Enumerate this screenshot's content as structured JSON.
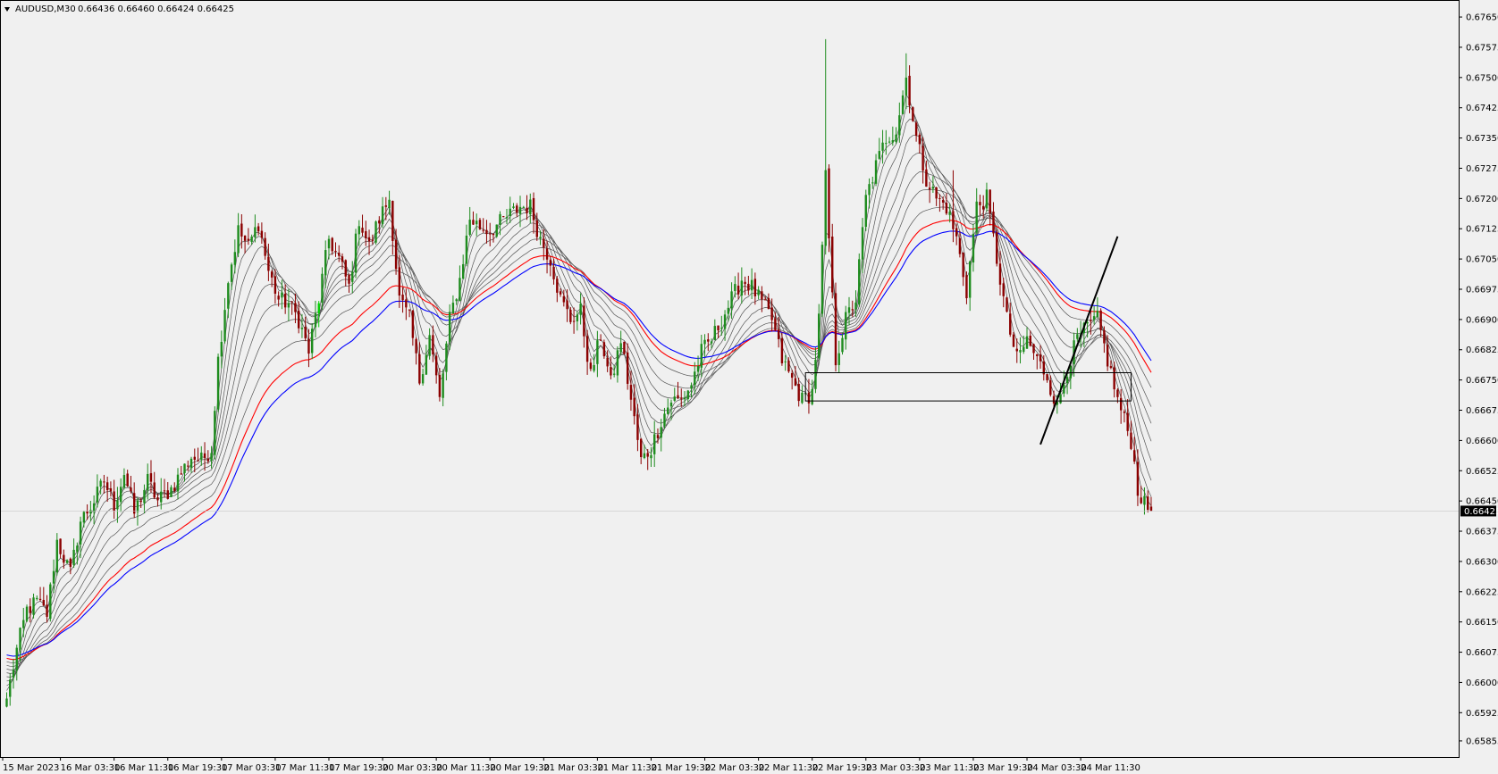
{
  "header": {
    "symbol": "AUDUSD,M30",
    "ohlc": "0.66436 0.66460 0.66424 0.66425"
  },
  "colors": {
    "background": "#f0f0f0",
    "bull_candle": "#1e8c1e",
    "bear_candle": "#8b0000",
    "ema_red": "#ff0000",
    "ema_blue": "#0000ff",
    "ema_gray": "#555555",
    "current_price_box": "#000000",
    "trendline": "#000000",
    "highlight_candle": "#00d000"
  },
  "chart_data": {
    "type": "candlestick",
    "title": "AUDUSD,M30",
    "ylim": [
      0.65815,
      0.6769
    ],
    "y_ticks": [
      0.6765,
      0.67575,
      0.675,
      0.67425,
      0.6735,
      0.67275,
      0.672,
      0.67125,
      0.6705,
      0.66975,
      0.669,
      0.66825,
      0.6675,
      0.66675,
      0.666,
      0.66525,
      0.6645,
      0.66375,
      0.663,
      0.66225,
      0.6615,
      0.66075,
      0.66,
      0.65925,
      0.65855
    ],
    "y_tick_labels": [
      "0.67650",
      "0.67575",
      "0.67500",
      "0.67425",
      "0.67350",
      "0.67275",
      "0.67200",
      "0.67125",
      "0.67050",
      "0.66975",
      "0.66900",
      "0.66825",
      "0.66750",
      "0.66675",
      "0.66600",
      "0.66525",
      "0.66450",
      "0.66375",
      "0.66300",
      "0.66225",
      "0.66150",
      "0.66075",
      "0.66000",
      "0.65925",
      "0.65855"
    ],
    "x_tick_labels": [
      "15 Mar 2023",
      "16 Mar 03:30",
      "16 Mar 11:30",
      "16 Mar 19:30",
      "17 Mar 03:30",
      "17 Mar 11:30",
      "17 Mar 19:30",
      "20 Mar 03:30",
      "20 Mar 11:30",
      "20 Mar 19:30",
      "21 Mar 03:30",
      "21 Mar 11:30",
      "21 Mar 19:30",
      "22 Mar 03:30",
      "22 Mar 11:30",
      "22 Mar 19:30",
      "23 Mar 03:30",
      "23 Mar 11:30",
      "23 Mar 19:30",
      "24 Mar 03:30",
      "24 Mar 11:30"
    ],
    "x_tick_index": [
      0,
      16,
      32,
      48,
      64,
      80,
      96,
      112,
      128,
      144,
      160,
      176,
      192,
      208,
      224,
      240,
      256,
      272,
      288,
      304,
      320
    ],
    "current_price": 0.66425,
    "current_price_label": "0.66425",
    "path_anchors": [
      [
        0,
        0.6596
      ],
      [
        3,
        0.6608
      ],
      [
        6,
        0.6618
      ],
      [
        9,
        0.662
      ],
      [
        12,
        0.6617
      ],
      [
        15,
        0.6635
      ],
      [
        19,
        0.6627
      ],
      [
        22,
        0.664
      ],
      [
        26,
        0.6645
      ],
      [
        29,
        0.665
      ],
      [
        32,
        0.6644
      ],
      [
        35,
        0.6652
      ],
      [
        38,
        0.6642
      ],
      [
        42,
        0.665
      ],
      [
        45,
        0.6645
      ],
      [
        49,
        0.6648
      ],
      [
        52,
        0.6652
      ],
      [
        55,
        0.6656
      ],
      [
        58,
        0.6655
      ],
      [
        61,
        0.6658
      ],
      [
        63,
        0.668
      ],
      [
        66,
        0.67
      ],
      [
        69,
        0.6712
      ],
      [
        72,
        0.6708
      ],
      [
        75,
        0.6714
      ],
      [
        78,
        0.6702
      ],
      [
        81,
        0.6695
      ],
      [
        84,
        0.6694
      ],
      [
        87,
        0.669
      ],
      [
        90,
        0.6682
      ],
      [
        93,
        0.6695
      ],
      [
        96,
        0.671
      ],
      [
        99,
        0.6705
      ],
      [
        102,
        0.6698
      ],
      [
        105,
        0.6715
      ],
      [
        108,
        0.6708
      ],
      [
        111,
        0.6715
      ],
      [
        114,
        0.672
      ],
      [
        117,
        0.6695
      ],
      [
        120,
        0.669
      ],
      [
        123,
        0.6675
      ],
      [
        126,
        0.6686
      ],
      [
        129,
        0.667
      ],
      [
        132,
        0.669
      ],
      [
        135,
        0.67
      ],
      [
        138,
        0.6715
      ],
      [
        141,
        0.6713
      ],
      [
        144,
        0.6712
      ],
      [
        147,
        0.6714
      ],
      [
        150,
        0.6716
      ],
      [
        153,
        0.6718
      ],
      [
        156,
        0.6718
      ],
      [
        159,
        0.671
      ],
      [
        162,
        0.6705
      ],
      [
        165,
        0.6695
      ],
      [
        168,
        0.669
      ],
      [
        171,
        0.6692
      ],
      [
        174,
        0.6676
      ],
      [
        177,
        0.6686
      ],
      [
        180,
        0.6674
      ],
      [
        183,
        0.6685
      ],
      [
        186,
        0.667
      ],
      [
        189,
        0.6655
      ],
      [
        192,
        0.6658
      ],
      [
        195,
        0.6665
      ],
      [
        198,
        0.667
      ],
      [
        201,
        0.667
      ],
      [
        204,
        0.6674
      ],
      [
        207,
        0.6682
      ],
      [
        210,
        0.6685
      ],
      [
        213,
        0.669
      ],
      [
        216,
        0.6695
      ],
      [
        219,
        0.67
      ],
      [
        222,
        0.6698
      ],
      [
        225,
        0.6694
      ],
      [
        228,
        0.669
      ],
      [
        231,
        0.668
      ],
      [
        234,
        0.6675
      ],
      [
        237,
        0.667
      ],
      [
        240,
        0.6672
      ],
      [
        242,
        0.669
      ],
      [
        244,
        0.6725
      ],
      [
        247,
        0.668
      ],
      [
        250,
        0.669
      ],
      [
        253,
        0.6695
      ],
      [
        256,
        0.672
      ],
      [
        259,
        0.6728
      ],
      [
        262,
        0.6735
      ],
      [
        265,
        0.6737
      ],
      [
        268,
        0.675
      ],
      [
        271,
        0.6735
      ],
      [
        274,
        0.6725
      ],
      [
        277,
        0.672
      ],
      [
        280,
        0.6718
      ],
      [
        283,
        0.671
      ],
      [
        286,
        0.6697
      ],
      [
        289,
        0.6718
      ],
      [
        292,
        0.672
      ],
      [
        295,
        0.6705
      ],
      [
        298,
        0.669
      ],
      [
        301,
        0.668
      ],
      [
        304,
        0.6685
      ],
      [
        307,
        0.668
      ],
      [
        310,
        0.6676
      ],
      [
        313,
        0.6668
      ],
      [
        316,
        0.6678
      ],
      [
        319,
        0.6685
      ],
      [
        322,
        0.6688
      ],
      [
        325,
        0.669
      ],
      [
        328,
        0.668
      ],
      [
        331,
        0.667
      ],
      [
        333,
        0.6665
      ],
      [
        335,
        0.666
      ],
      [
        337,
        0.6648
      ],
      [
        339,
        0.6644
      ],
      [
        341,
        0.66425
      ]
    ],
    "ema_periods": [
      3,
      5,
      8,
      12,
      17,
      23,
      30,
      40,
      50,
      60
    ],
    "rectangle": {
      "x_start": 238,
      "x_end": 335,
      "y_top": 0.66768,
      "y_bottom": 0.66698
    },
    "trendline": {
      "x1": 308,
      "y1": 0.6659,
      "x2": 331,
      "y2": 0.67106
    }
  }
}
